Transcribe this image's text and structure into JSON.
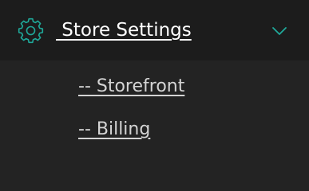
{
  "menu": {
    "header": {
      "icon": "gear-icon",
      "label": " Store Settings",
      "expanded_icon": "chevron-down-icon",
      "accent_color": "#1fa99a"
    },
    "items": [
      {
        "label": "-- Storefront"
      },
      {
        "label": "-- Billing"
      }
    ]
  }
}
